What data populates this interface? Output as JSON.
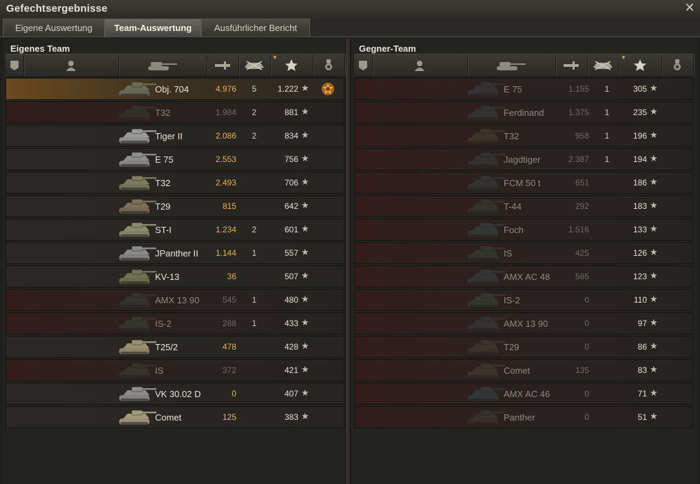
{
  "window": {
    "title": "Gefechtsergebnisse",
    "close_icon": "close-icon"
  },
  "tabs": [
    {
      "label": "Eigene Auswertung",
      "active": false
    },
    {
      "label": "Team-Auswertung",
      "active": true
    },
    {
      "label": "Ausführlicher Bericht",
      "active": false
    }
  ],
  "left_team": {
    "title": "Eigenes Team",
    "players": [
      {
        "vehicle": "Obj. 704",
        "damage": "4.976",
        "kills": "5",
        "xp": "1.222",
        "state": "own",
        "medal": true,
        "tank_color": "#6b6a55"
      },
      {
        "vehicle": "T32",
        "damage": "1.984",
        "kills": "2",
        "xp": "881",
        "state": "dead",
        "medal": false,
        "tank_color": "#3d3d36"
      },
      {
        "vehicle": "Tiger II",
        "damage": "2.086",
        "kills": "2",
        "xp": "834",
        "state": "alive",
        "medal": false,
        "tank_color": "#9a9a96"
      },
      {
        "vehicle": "E 75",
        "damage": "2.553",
        "kills": "",
        "xp": "756",
        "state": "alive",
        "medal": false,
        "tank_color": "#8e8e8a"
      },
      {
        "vehicle": "T32",
        "damage": "2.493",
        "kills": "",
        "xp": "706",
        "state": "alive",
        "medal": false,
        "tank_color": "#7c7a60"
      },
      {
        "vehicle": "T29",
        "damage": "815",
        "kills": "",
        "xp": "642",
        "state": "alive",
        "medal": false,
        "tank_color": "#7d6f58"
      },
      {
        "vehicle": "ST-I",
        "damage": "1.234",
        "kills": "2",
        "xp": "601",
        "state": "alive",
        "medal": false,
        "tank_color": "#8a8b6a"
      },
      {
        "vehicle": "JPanther II",
        "damage": "1.144",
        "kills": "1",
        "xp": "557",
        "state": "alive",
        "medal": false,
        "tank_color": "#8a8a86"
      },
      {
        "vehicle": "KV-13",
        "damage": "36",
        "kills": "",
        "xp": "507",
        "state": "alive",
        "medal": false,
        "tank_color": "#6f7354"
      },
      {
        "vehicle": "AMX 13 90",
        "damage": "545",
        "kills": "1",
        "xp": "480",
        "state": "dead",
        "medal": false,
        "tank_color": "#3b4140"
      },
      {
        "vehicle": "IS-2",
        "damage": "288",
        "kills": "1",
        "xp": "433",
        "state": "dead",
        "medal": false,
        "tank_color": "#3b4a3b"
      },
      {
        "vehicle": "T25/2",
        "damage": "478",
        "kills": "",
        "xp": "428",
        "state": "alive",
        "medal": false,
        "tank_color": "#9a9070"
      },
      {
        "vehicle": "IS",
        "damage": "372",
        "kills": "",
        "xp": "421",
        "state": "dead",
        "medal": false,
        "tank_color": "#3a4438"
      },
      {
        "vehicle": "VK 30.02 D",
        "damage": "0",
        "kills": "",
        "xp": "407",
        "state": "alive",
        "medal": false,
        "tank_color": "#8d8c88"
      },
      {
        "vehicle": "Comet",
        "damage": "125",
        "kills": "",
        "xp": "383",
        "state": "alive",
        "medal": false,
        "tank_color": "#a39a7c"
      }
    ]
  },
  "right_team": {
    "title": "Gegner-Team",
    "players": [
      {
        "vehicle": "E 75",
        "damage": "1.155",
        "kills": "1",
        "xp": "305",
        "state": "dead",
        "tank_color": "#3c4244"
      },
      {
        "vehicle": "Ferdinand",
        "damage": "1.375",
        "kills": "1",
        "xp": "235",
        "state": "dead",
        "tank_color": "#3b4240"
      },
      {
        "vehicle": "T32",
        "damage": "958",
        "kills": "1",
        "xp": "196",
        "state": "dead",
        "tank_color": "#4a4536"
      },
      {
        "vehicle": "Jagdtiger",
        "damage": "2.387",
        "kills": "1",
        "xp": "194",
        "state": "dead",
        "tank_color": "#3c4040"
      },
      {
        "vehicle": "FCM 50 t",
        "damage": "651",
        "kills": "",
        "xp": "186",
        "state": "dead",
        "tank_color": "#384340"
      },
      {
        "vehicle": "T-44",
        "damage": "292",
        "kills": "",
        "xp": "183",
        "state": "dead",
        "tank_color": "#3a4236"
      },
      {
        "vehicle": "Foch",
        "damage": "1.516",
        "kills": "",
        "xp": "133",
        "state": "dead",
        "tank_color": "#3a4c4a"
      },
      {
        "vehicle": "IS",
        "damage": "425",
        "kills": "",
        "xp": "126",
        "state": "dead",
        "tank_color": "#3a4438"
      },
      {
        "vehicle": "AMX AC 48",
        "damage": "585",
        "kills": "",
        "xp": "123",
        "state": "dead",
        "tank_color": "#3a4848"
      },
      {
        "vehicle": "IS-2",
        "damage": "0",
        "kills": "",
        "xp": "110",
        "state": "dead",
        "tank_color": "#3b4a3b"
      },
      {
        "vehicle": "AMX 13 90",
        "damage": "0",
        "kills": "",
        "xp": "97",
        "state": "dead",
        "tank_color": "#3b4140"
      },
      {
        "vehicle": "T29",
        "damage": "0",
        "kills": "",
        "xp": "86",
        "state": "dead",
        "tank_color": "#4a4232"
      },
      {
        "vehicle": "Comet",
        "damage": "135",
        "kills": "",
        "xp": "83",
        "state": "dead",
        "tank_color": "#4a4638"
      },
      {
        "vehicle": "AMX AC 46",
        "damage": "0",
        "kills": "",
        "xp": "71",
        "state": "dead",
        "tank_color": "#384a4a"
      },
      {
        "vehicle": "Panther",
        "damage": "0",
        "kills": "",
        "xp": "51",
        "state": "dead",
        "tank_color": "#3d4034"
      }
    ]
  },
  "header_icons": [
    "squad-icon",
    "player-icon",
    "vehicle-icon",
    "damage-icon",
    "kills-icon",
    "xp-star-icon",
    "medal-icon"
  ],
  "star_glyph": "★"
}
